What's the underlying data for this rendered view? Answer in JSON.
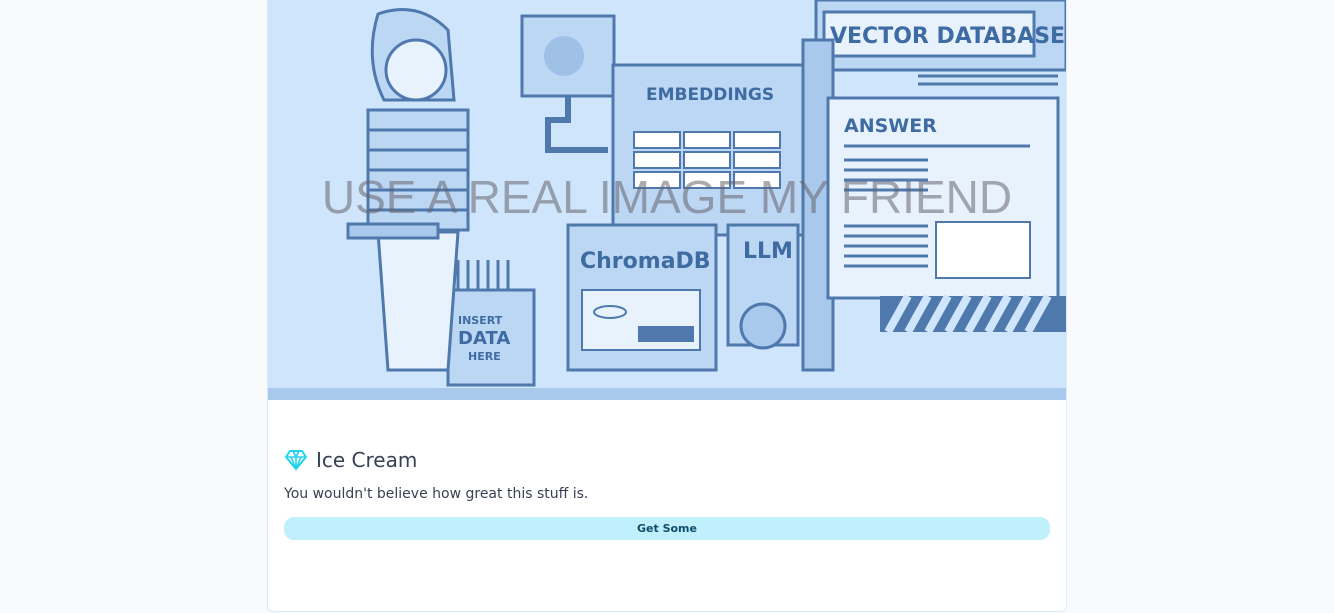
{
  "hero": {
    "overlay_text": "USE A REAL IMAGE MY FRIEND",
    "labels": {
      "vector_database": "VECTOR DATABASE",
      "embeddings": "EMBEDDINGS",
      "answer": "ANSWER",
      "chromadb": "ChromaDB",
      "llm": "LLM",
      "insert": "INSERT",
      "data": "DATA",
      "here": "HERE"
    }
  },
  "card": {
    "icon": "gem-icon",
    "title": "Ice Cream",
    "description": "You wouldn't believe how great this stuff is.",
    "button_label": "Get Some"
  },
  "colors": {
    "accent": "#22d3ee",
    "button_bg": "#c0f0fb",
    "button_text": "#0e4e6b",
    "hero_bg": "#cfe5fb"
  }
}
